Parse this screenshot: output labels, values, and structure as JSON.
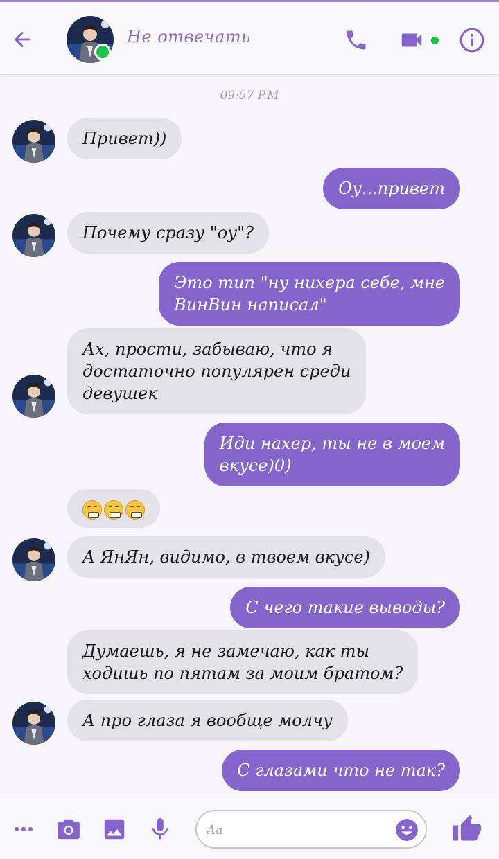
{
  "header": {
    "contact_name": "Не отвечать",
    "status": "online"
  },
  "conversation": {
    "timestamp": "09:57 P.M",
    "messages": [
      {
        "dir": "in",
        "lines": [
          "Привет))"
        ]
      },
      {
        "dir": "out",
        "lines": [
          "Оу...привет"
        ]
      },
      {
        "dir": "in",
        "lines": [
          "Почему сразу \"оу\"?"
        ]
      },
      {
        "dir": "out",
        "lines": [
          "Это тип \"ну нихера себе, мне",
          "ВинВин написал\""
        ]
      },
      {
        "dir": "in",
        "lines": [
          "Ах, прости, забываю, что я",
          "достаточно популярен среди",
          "девушек"
        ]
      },
      {
        "dir": "out",
        "lines": [
          "Иди нахер, ты не в моем",
          "вкусе)0)"
        ]
      },
      {
        "dir": "in",
        "emoji": [
          "grimacing-face",
          "grimacing-face",
          "grimacing-face"
        ]
      },
      {
        "dir": "in",
        "lines": [
          "А ЯнЯн, видимо, в твоем вкусе)"
        ]
      },
      {
        "dir": "out",
        "lines": [
          "С чего такие выводы?"
        ]
      },
      {
        "dir": "in",
        "lines": [
          "Думаешь, я не замечаю, как ты",
          "ходишь по пятам за моим братом?"
        ]
      },
      {
        "dir": "in",
        "lines": [
          "А про глаза я вообще молчу"
        ]
      },
      {
        "dir": "out",
        "lines": [
          "С глазами что не так?"
        ]
      }
    ]
  },
  "composer": {
    "placeholder": "Aa"
  },
  "colors": {
    "accent": "#8565cc",
    "incoming_bubble": "#e3e2e6",
    "online": "#1cc54a"
  },
  "icons": {
    "back": "arrow-left-icon",
    "call": "phone-icon",
    "video": "video-camera-icon",
    "info": "info-icon",
    "more": "more-dots-icon",
    "camera": "camera-icon",
    "gallery": "image-icon",
    "mic": "microphone-icon",
    "emoji": "smiley-icon",
    "like": "thumbs-up-icon"
  }
}
